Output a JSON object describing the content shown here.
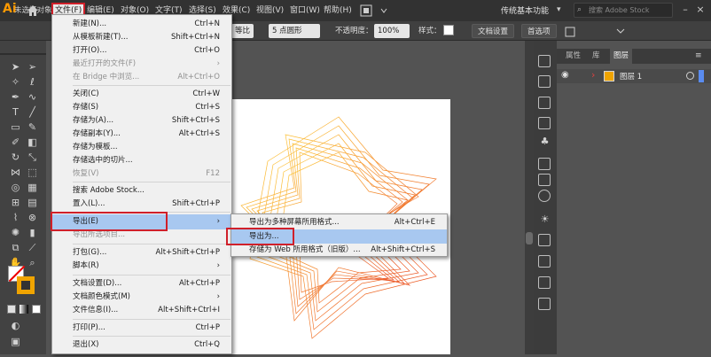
{
  "colors": {
    "accent": "#ff9a00",
    "highlight": "#a8c8f0",
    "annotation_red": "#d0202a"
  },
  "app": {
    "logo": "Ai",
    "preset": "传统基本功能",
    "search_placeholder": "搜索 Adobe Stock"
  },
  "menubar": {
    "items": [
      "文件(F)",
      "编辑(E)",
      "对象(O)",
      "文字(T)",
      "选择(S)",
      "效果(C)",
      "视图(V)",
      "窗口(W)",
      "帮助(H)"
    ]
  },
  "control_bar": {
    "no_selection": "未选择对象",
    "proportion": "等比",
    "brush": "5 点圆形",
    "opacity_label": "不透明度：",
    "opacity_value": "100%",
    "style_label": "样式：",
    "doc_setup": "文档设置",
    "prefs": "首选项"
  },
  "file_menu": {
    "items": [
      {
        "label": "新建(N)...",
        "shortcut": "Ctrl+N"
      },
      {
        "label": "从模板新建(T)...",
        "shortcut": "Shift+Ctrl+N"
      },
      {
        "label": "打开(O)...",
        "shortcut": "Ctrl+O"
      },
      {
        "label": "最近打开的文件(F)",
        "shortcut": "›"
      },
      {
        "label": "在 Bridge 中浏览...",
        "shortcut": "Alt+Ctrl+O"
      },
      {
        "label": "关闭(C)",
        "shortcut": "Ctrl+W"
      },
      {
        "label": "存储(S)",
        "shortcut": "Ctrl+S"
      },
      {
        "label": "存储为(A)...",
        "shortcut": "Shift+Ctrl+S"
      },
      {
        "label": "存储副本(Y)...",
        "shortcut": "Alt+Ctrl+S"
      },
      {
        "label": "存储为模板...",
        "shortcut": ""
      },
      {
        "label": "存储选中的切片...",
        "shortcut": ""
      },
      {
        "label": "恢复(V)",
        "shortcut": "F12"
      },
      {
        "label": "搜索 Adobe Stock...",
        "shortcut": ""
      },
      {
        "label": "置入(L)...",
        "shortcut": "Shift+Ctrl+P"
      },
      {
        "label": "导出(E)",
        "shortcut": "›"
      },
      {
        "label": "导出所选项目...",
        "shortcut": ""
      },
      {
        "label": "打包(G)...",
        "shortcut": "Alt+Shift+Ctrl+P"
      },
      {
        "label": "脚本(R)",
        "shortcut": "›"
      },
      {
        "label": "文档设置(D)...",
        "shortcut": "Alt+Ctrl+P"
      },
      {
        "label": "文档颜色模式(M)",
        "shortcut": "›"
      },
      {
        "label": "文件信息(I)...",
        "shortcut": "Alt+Shift+Ctrl+I"
      },
      {
        "label": "打印(P)...",
        "shortcut": "Ctrl+P"
      },
      {
        "label": "退出(X)",
        "shortcut": "Ctrl+Q"
      }
    ]
  },
  "export_submenu": {
    "items": [
      {
        "label": "导出为多种屏幕所用格式...",
        "shortcut": "Alt+Ctrl+E"
      },
      {
        "label": "导出为...",
        "shortcut": ""
      },
      {
        "label": "存储为 Web 所用格式（旧版）...",
        "shortcut": "Alt+Shift+Ctrl+S"
      }
    ]
  },
  "panel": {
    "tabs": [
      "属性",
      "库",
      "图层"
    ],
    "layer_name": "图层 1"
  }
}
